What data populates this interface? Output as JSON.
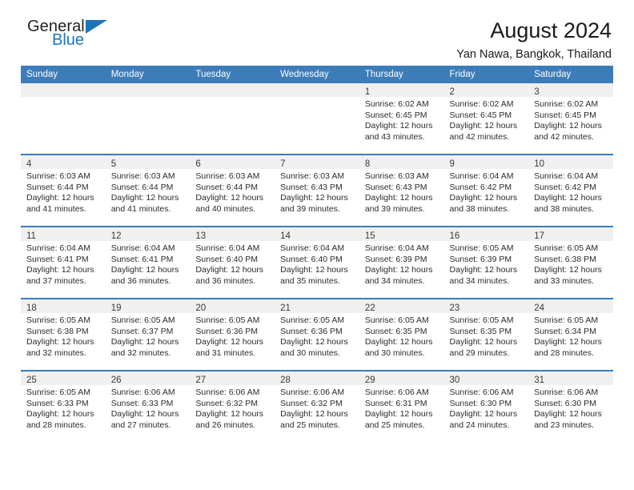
{
  "brand": {
    "name_part1": "General",
    "name_part2": "Blue",
    "triangle_icon": "blue-triangle-icon",
    "color_dark": "#231f20",
    "color_blue": "#1b75bb"
  },
  "header": {
    "title": "August 2024",
    "subtitle": "Yan Nawa, Bangkok, Thailand",
    "accent_color": "#3c7cb9",
    "band_color": "#f0f0f0"
  },
  "weekday_headers": [
    "Sunday",
    "Monday",
    "Tuesday",
    "Wednesday",
    "Thursday",
    "Friday",
    "Saturday"
  ],
  "labels": {
    "sunrise_prefix": "Sunrise:",
    "sunset_prefix": "Sunset:",
    "daylight_prefix": "Daylight:"
  },
  "weeks": [
    [
      {
        "day": "",
        "empty": true
      },
      {
        "day": "",
        "empty": true
      },
      {
        "day": "",
        "empty": true
      },
      {
        "day": "",
        "empty": true
      },
      {
        "day": "1",
        "sunrise": "Sunrise: 6:02 AM",
        "sunset": "Sunset: 6:45 PM",
        "daylight": "Daylight: 12 hours and 43 minutes."
      },
      {
        "day": "2",
        "sunrise": "Sunrise: 6:02 AM",
        "sunset": "Sunset: 6:45 PM",
        "daylight": "Daylight: 12 hours and 42 minutes."
      },
      {
        "day": "3",
        "sunrise": "Sunrise: 6:02 AM",
        "sunset": "Sunset: 6:45 PM",
        "daylight": "Daylight: 12 hours and 42 minutes."
      }
    ],
    [
      {
        "day": "4",
        "sunrise": "Sunrise: 6:03 AM",
        "sunset": "Sunset: 6:44 PM",
        "daylight": "Daylight: 12 hours and 41 minutes."
      },
      {
        "day": "5",
        "sunrise": "Sunrise: 6:03 AM",
        "sunset": "Sunset: 6:44 PM",
        "daylight": "Daylight: 12 hours and 41 minutes."
      },
      {
        "day": "6",
        "sunrise": "Sunrise: 6:03 AM",
        "sunset": "Sunset: 6:44 PM",
        "daylight": "Daylight: 12 hours and 40 minutes."
      },
      {
        "day": "7",
        "sunrise": "Sunrise: 6:03 AM",
        "sunset": "Sunset: 6:43 PM",
        "daylight": "Daylight: 12 hours and 39 minutes."
      },
      {
        "day": "8",
        "sunrise": "Sunrise: 6:03 AM",
        "sunset": "Sunset: 6:43 PM",
        "daylight": "Daylight: 12 hours and 39 minutes."
      },
      {
        "day": "9",
        "sunrise": "Sunrise: 6:04 AM",
        "sunset": "Sunset: 6:42 PM",
        "daylight": "Daylight: 12 hours and 38 minutes."
      },
      {
        "day": "10",
        "sunrise": "Sunrise: 6:04 AM",
        "sunset": "Sunset: 6:42 PM",
        "daylight": "Daylight: 12 hours and 38 minutes."
      }
    ],
    [
      {
        "day": "11",
        "sunrise": "Sunrise: 6:04 AM",
        "sunset": "Sunset: 6:41 PM",
        "daylight": "Daylight: 12 hours and 37 minutes."
      },
      {
        "day": "12",
        "sunrise": "Sunrise: 6:04 AM",
        "sunset": "Sunset: 6:41 PM",
        "daylight": "Daylight: 12 hours and 36 minutes."
      },
      {
        "day": "13",
        "sunrise": "Sunrise: 6:04 AM",
        "sunset": "Sunset: 6:40 PM",
        "daylight": "Daylight: 12 hours and 36 minutes."
      },
      {
        "day": "14",
        "sunrise": "Sunrise: 6:04 AM",
        "sunset": "Sunset: 6:40 PM",
        "daylight": "Daylight: 12 hours and 35 minutes."
      },
      {
        "day": "15",
        "sunrise": "Sunrise: 6:04 AM",
        "sunset": "Sunset: 6:39 PM",
        "daylight": "Daylight: 12 hours and 34 minutes."
      },
      {
        "day": "16",
        "sunrise": "Sunrise: 6:05 AM",
        "sunset": "Sunset: 6:39 PM",
        "daylight": "Daylight: 12 hours and 34 minutes."
      },
      {
        "day": "17",
        "sunrise": "Sunrise: 6:05 AM",
        "sunset": "Sunset: 6:38 PM",
        "daylight": "Daylight: 12 hours and 33 minutes."
      }
    ],
    [
      {
        "day": "18",
        "sunrise": "Sunrise: 6:05 AM",
        "sunset": "Sunset: 6:38 PM",
        "daylight": "Daylight: 12 hours and 32 minutes."
      },
      {
        "day": "19",
        "sunrise": "Sunrise: 6:05 AM",
        "sunset": "Sunset: 6:37 PM",
        "daylight": "Daylight: 12 hours and 32 minutes."
      },
      {
        "day": "20",
        "sunrise": "Sunrise: 6:05 AM",
        "sunset": "Sunset: 6:36 PM",
        "daylight": "Daylight: 12 hours and 31 minutes."
      },
      {
        "day": "21",
        "sunrise": "Sunrise: 6:05 AM",
        "sunset": "Sunset: 6:36 PM",
        "daylight": "Daylight: 12 hours and 30 minutes."
      },
      {
        "day": "22",
        "sunrise": "Sunrise: 6:05 AM",
        "sunset": "Sunset: 6:35 PM",
        "daylight": "Daylight: 12 hours and 30 minutes."
      },
      {
        "day": "23",
        "sunrise": "Sunrise: 6:05 AM",
        "sunset": "Sunset: 6:35 PM",
        "daylight": "Daylight: 12 hours and 29 minutes."
      },
      {
        "day": "24",
        "sunrise": "Sunrise: 6:05 AM",
        "sunset": "Sunset: 6:34 PM",
        "daylight": "Daylight: 12 hours and 28 minutes."
      }
    ],
    [
      {
        "day": "25",
        "sunrise": "Sunrise: 6:05 AM",
        "sunset": "Sunset: 6:33 PM",
        "daylight": "Daylight: 12 hours and 28 minutes."
      },
      {
        "day": "26",
        "sunrise": "Sunrise: 6:06 AM",
        "sunset": "Sunset: 6:33 PM",
        "daylight": "Daylight: 12 hours and 27 minutes."
      },
      {
        "day": "27",
        "sunrise": "Sunrise: 6:06 AM",
        "sunset": "Sunset: 6:32 PM",
        "daylight": "Daylight: 12 hours and 26 minutes."
      },
      {
        "day": "28",
        "sunrise": "Sunrise: 6:06 AM",
        "sunset": "Sunset: 6:32 PM",
        "daylight": "Daylight: 12 hours and 25 minutes."
      },
      {
        "day": "29",
        "sunrise": "Sunrise: 6:06 AM",
        "sunset": "Sunset: 6:31 PM",
        "daylight": "Daylight: 12 hours and 25 minutes."
      },
      {
        "day": "30",
        "sunrise": "Sunrise: 6:06 AM",
        "sunset": "Sunset: 6:30 PM",
        "daylight": "Daylight: 12 hours and 24 minutes."
      },
      {
        "day": "31",
        "sunrise": "Sunrise: 6:06 AM",
        "sunset": "Sunset: 6:30 PM",
        "daylight": "Daylight: 12 hours and 23 minutes."
      }
    ]
  ]
}
